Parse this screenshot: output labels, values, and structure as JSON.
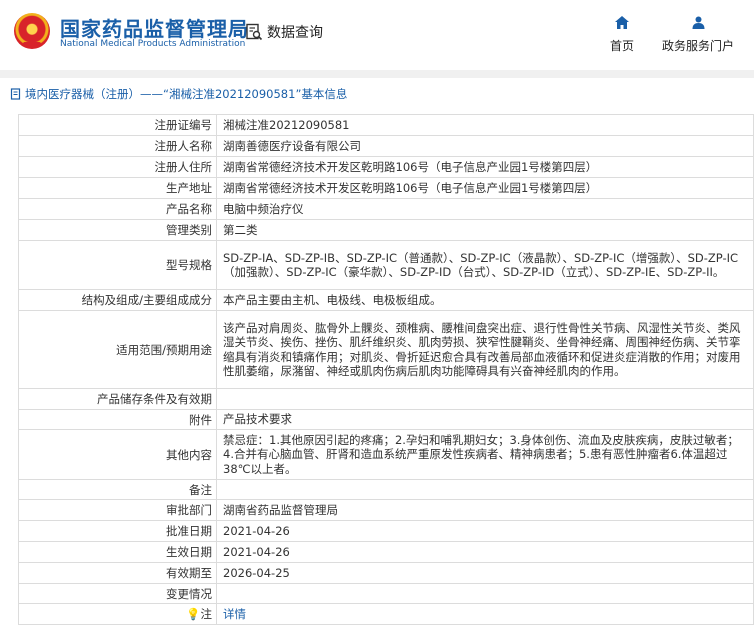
{
  "header": {
    "brand_cn": "国家药品监督管理局",
    "brand_en": "National Medical Products Administration",
    "query_label": "数据查询",
    "nav_home": "首页",
    "nav_gov": "政务服务门户"
  },
  "breadcrumb": "境内医疗器械（注册）——“湘械注准20212090581”基本信息",
  "rows": [
    {
      "key": "注册证编号",
      "value": "湘械注准20212090581"
    },
    {
      "key": "注册人名称",
      "value": "湖南善德医疗设备有限公司"
    },
    {
      "key": "注册人住所",
      "value": "湖南省常德经济技术开发区乾明路106号（电子信息产业园1号楼第四层）"
    },
    {
      "key": "生产地址",
      "value": "湖南省常德经济技术开发区乾明路106号（电子信息产业园1号楼第四层）"
    },
    {
      "key": "产品名称",
      "value": "电脑中频治疗仪"
    },
    {
      "key": "管理类别",
      "value": "第二类"
    },
    {
      "key": "型号规格",
      "value": "SD-ZP-IA、SD-ZP-IB、SD-ZP-IC（普通款）、SD-ZP-IC（液晶款）、SD-ZP-IC（增强款）、SD-ZP-IC（加强款）、SD-ZP-IC（豪华款）、SD-ZP-ID（台式）、SD-ZP-ID（立式）、SD-ZP-IE、SD-ZP-II。"
    },
    {
      "key": "结构及组成/主要组成成分",
      "value": "本产品主要由主机、电极线、电极板组成。"
    },
    {
      "key": "适用范围/预期用途",
      "value": "该产品对肩周炎、肱骨外上髁炎、颈椎病、腰椎间盘突出症、退行性骨性关节病、风湿性关节炎、类风湿关节炎、挨伤、挫伤、肌纤维织炎、肌肉劳损、狭窄性腱鞘炎、坐骨神经痛、周围神经伤病、关节挛缩具有消炎和镇痛作用；对肌炎、骨折延迟愈合具有改善局部血液循环和促进炎症消散的作用；对废用性肌萎缩，尿潴留、神经或肌肉伤病后肌肉功能障碍具有兴奋神经肌肉的作用。"
    },
    {
      "key": "产品储存条件及有效期",
      "value": ""
    },
    {
      "key": "附件",
      "value": "产品技术要求"
    },
    {
      "key": "其他内容",
      "value": "禁忌症：1.其他原因引起的疼痛；2.孕妇和哺乳期妇女；3.身体创伤、流血及皮肤疾病，皮肤过敏者；4.合并有心脑血管、肝肾和造血系统严重原发性疾病者、精神病患者；5.患有恶性肿瘤者6.体温超过38℃以上者。"
    },
    {
      "key": "备注",
      "value": ""
    },
    {
      "key": "审批部门",
      "value": "湖南省药品监督管理局"
    },
    {
      "key": "批准日期",
      "value": "2021-04-26"
    },
    {
      "key": "生效日期",
      "value": "2021-04-26"
    },
    {
      "key": "有效期至",
      "value": "2026-04-25"
    },
    {
      "key": "变更情况",
      "value": ""
    },
    {
      "key": "注",
      "value": "详情"
    }
  ]
}
